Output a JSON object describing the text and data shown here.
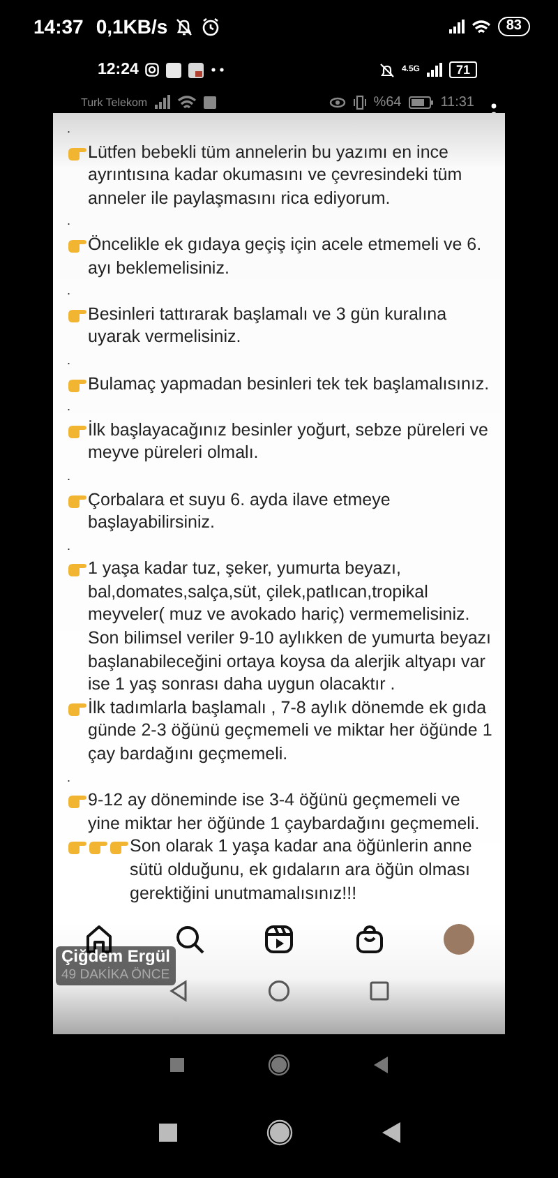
{
  "status_bar": {
    "time": "14:37",
    "speed": "0,1KB/s",
    "battery": "83"
  },
  "inner_status_bar": {
    "time": "12:24",
    "network": "4.5G",
    "battery": "71"
  },
  "shared_status_bar": {
    "carrier": "Turk Telekom",
    "battery_percent": "%64",
    "time": "11:31"
  },
  "post": {
    "blocks": [
      {
        "kind": "dot",
        "text": "."
      },
      {
        "kind": "point",
        "text": "Lütfen bebekli tüm annelerin bu yazımı en ince ayrıntısına kadar okumasını ve çevresindeki tüm anneler ile paylaşmasını rica ediyorum."
      },
      {
        "kind": "dot",
        "text": "."
      },
      {
        "kind": "point",
        "text": "Öncelikle ek gıdaya geçiş için acele etmemeli ve 6. ayı beklemelisiniz."
      },
      {
        "kind": "dot",
        "text": "."
      },
      {
        "kind": "point",
        "text": "Besinleri tattırarak başlamalı ve 3 gün kuralına uyarak vermelisiniz."
      },
      {
        "kind": "dot",
        "text": "."
      },
      {
        "kind": "point",
        "text": "Bulamaç yapmadan besinleri tek tek başlamalısınız."
      },
      {
        "kind": "dot",
        "text": "."
      },
      {
        "kind": "point",
        "text": "İlk başlayacağınız besinler yoğurt, sebze püreleri ve meyve püreleri olmalı."
      },
      {
        "kind": "dot",
        "text": "."
      },
      {
        "kind": "point",
        "text": "Çorbalara et suyu 6. ayda ilave etmeye başlayabilirsiniz."
      },
      {
        "kind": "dot",
        "text": "."
      },
      {
        "kind": "point",
        "text": "1 yaşa kadar tuz, şeker, yumurta beyazı, bal,domates,salça,süt, çilek,patlıcan,tropikal meyveler( muz ve avokado hariç)  vermemelisiniz. Son bilimsel veriler 9-10 aylıkken de yumurta beyazı başlanabileceğini ortaya koysa da alerjik altyapı var ise  1 yaş sonrası daha uygun olacaktır ."
      },
      {
        "kind": "point",
        "text": "İlk tadımlarla  başlamalı , 7-8 aylık dönemde ek gıda günde 2-3 öğünü geçmemeli ve miktar  her öğünde 1 çay bardağını geçmemeli."
      },
      {
        "kind": "dot",
        "text": "."
      },
      {
        "kind": "point",
        "text": "9-12 ay döneminde ise 3-4 öğünü geçmemeli ve yine miktar her öğünde 1 çaybardağını geçmemeli."
      },
      {
        "kind": "triple_point",
        "text": "Son olarak 1 yaşa kadar ana öğünlerin anne sütü olduğunu, ek gıdaların ara öğün olması gerektiğini unutmamalısınız!!!"
      }
    ]
  },
  "author": {
    "name": "Çiğdem Ergül",
    "time": "49 DAKİKA ÖNCE"
  }
}
